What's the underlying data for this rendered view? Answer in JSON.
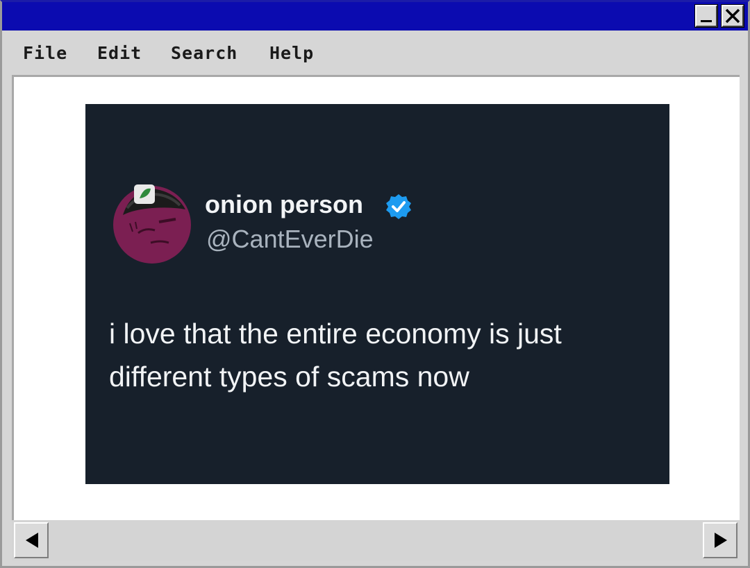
{
  "window": {
    "minimize_icon": "minimize-icon",
    "close_icon": "close-icon",
    "titlebar_color": "#0b0bb0"
  },
  "menu": {
    "file": "File",
    "edit": "Edit",
    "search": "Search",
    "help": "Help"
  },
  "tweet": {
    "display_name": "onion person",
    "handle": "@CantEverDie",
    "text_line1": "i love that the entire economy is just",
    "text_line2": "different types of scams now",
    "verified_icon": "verified-badge-icon",
    "avatar_icon": "onion-avatar-icon",
    "background_color": "#17202b",
    "verified_color": "#1d9bf0",
    "avatar_color": "#7b1f52"
  },
  "scrollbar": {
    "left_icon": "arrow-left-icon",
    "right_icon": "arrow-right-icon"
  }
}
